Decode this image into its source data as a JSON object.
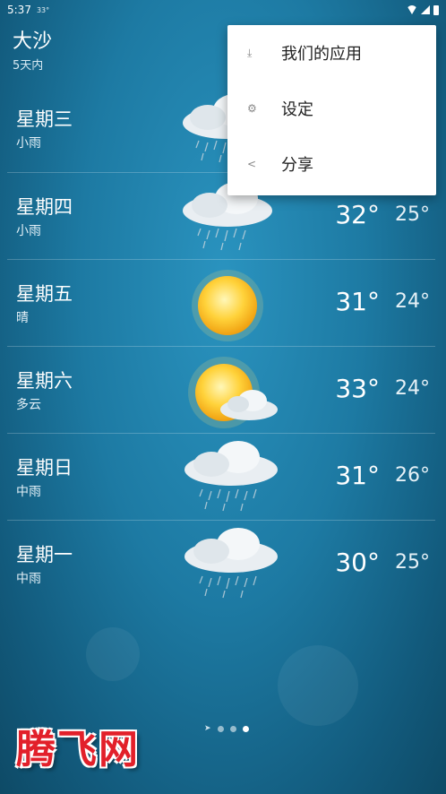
{
  "status_bar": {
    "time": "5:37",
    "temp_indicator": "33°"
  },
  "header": {
    "city": "大沙",
    "subtitle": "5天内"
  },
  "days": [
    {
      "day": "星期三",
      "condition": "小雨",
      "high": "",
      "low": "",
      "icon": "rain-cloud-icon"
    },
    {
      "day": "星期四",
      "condition": "小雨",
      "high": "32°",
      "low": "25°",
      "icon": "rain-cloud-icon"
    },
    {
      "day": "星期五",
      "condition": "晴",
      "high": "31°",
      "low": "24°",
      "icon": "sun-icon"
    },
    {
      "day": "星期六",
      "condition": "多云",
      "high": "33°",
      "low": "24°",
      "icon": "partly-cloudy-icon"
    },
    {
      "day": "星期日",
      "condition": "中雨",
      "high": "31°",
      "low": "26°",
      "icon": "rain-cloud-icon"
    },
    {
      "day": "星期一",
      "condition": "中雨",
      "high": "30°",
      "low": "25°",
      "icon": "rain-cloud-icon"
    }
  ],
  "menu": {
    "items": [
      {
        "label": "我们的应用",
        "icon": "download-icon"
      },
      {
        "label": "设定",
        "icon": "gear-icon"
      },
      {
        "label": "分享",
        "icon": "share-icon"
      }
    ]
  },
  "pager": {
    "count": 3,
    "active_index": 2
  },
  "watermark": "腾飞网"
}
